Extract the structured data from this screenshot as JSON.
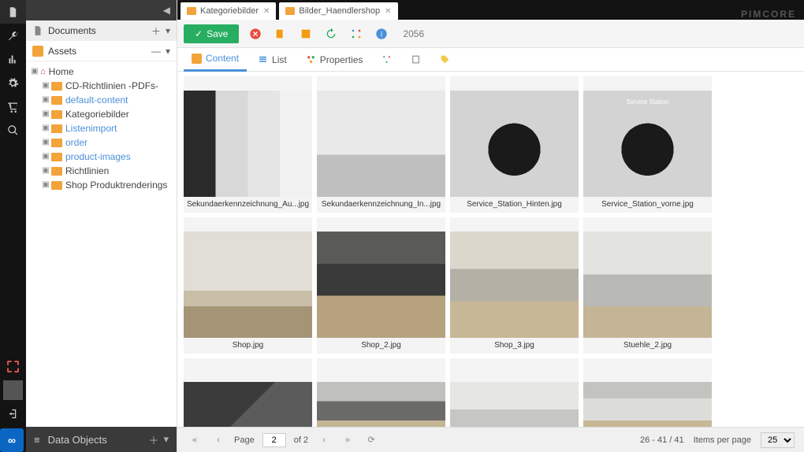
{
  "brand": "PIMCORE",
  "rail": {
    "icons": [
      "file-icon",
      "wrench-icon",
      "chart-icon",
      "gear-icon",
      "cart-icon",
      "search-icon"
    ]
  },
  "panels": {
    "documents": {
      "label": "Documents"
    },
    "assets": {
      "label": "Assets"
    },
    "dataObjects": {
      "label": "Data Objects"
    }
  },
  "tree": {
    "root": "Home",
    "items": [
      {
        "label": "CD-Richtlinien -PDFs-",
        "link": false
      },
      {
        "label": "default-content",
        "link": true
      },
      {
        "label": "Kategoriebilder",
        "link": false
      },
      {
        "label": "Listenimport",
        "link": true
      },
      {
        "label": "order",
        "link": true
      },
      {
        "label": "product-images",
        "link": true
      },
      {
        "label": "Richtlinien",
        "link": false
      },
      {
        "label": "Shop Produktrenderings",
        "link": false
      }
    ]
  },
  "tabs": [
    {
      "label": "Kategoriebilder"
    },
    {
      "label": "Bilder_Haendlershop"
    }
  ],
  "toolbar": {
    "save": "Save",
    "id": "2056"
  },
  "subtabs": {
    "content": "Content",
    "list": "List",
    "properties": "Properties"
  },
  "gallery": [
    {
      "name": "Sekundaerkennzeichnung_Au...jpg",
      "thumb": "t1"
    },
    {
      "name": "Sekundaerkennzeichnung_In...jpg",
      "thumb": "t2"
    },
    {
      "name": "Service_Station_Hinten.jpg",
      "thumb": "t3"
    },
    {
      "name": "Service_Station_vorne.jpg",
      "thumb": "t4"
    },
    {
      "name": "Shop.jpg",
      "thumb": "t5"
    },
    {
      "name": "Shop_2.jpg",
      "thumb": "t6"
    },
    {
      "name": "Shop_3.jpg",
      "thumb": "t7"
    },
    {
      "name": "Stuehle_2.jpg",
      "thumb": "t8"
    }
  ],
  "partialRow": [
    {
      "thumb": "t9"
    },
    {
      "thumb": "t10"
    },
    {
      "thumb": "t11"
    },
    {
      "thumb": "t12"
    }
  ],
  "pager": {
    "pageLabel": "Page",
    "page": "2",
    "ofLabel": "of 2",
    "range": "26 - 41 / 41",
    "itemsPerPage": "Items per page",
    "perPage": "25"
  }
}
